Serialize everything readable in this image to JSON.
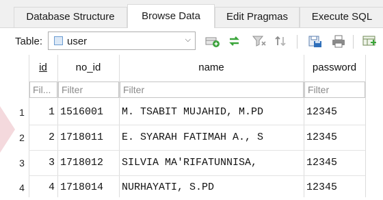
{
  "tabs": [
    {
      "label": "Database Structure",
      "active": false
    },
    {
      "label": "Browse Data",
      "active": true
    },
    {
      "label": "Edit Pragmas",
      "active": false
    },
    {
      "label": "Execute SQL",
      "active": false
    }
  ],
  "toolbar": {
    "table_label": "Table:",
    "table_value": "user",
    "icons": [
      "refresh-table-icon",
      "clear-filters-icon",
      "filter-icon",
      "sort-icon",
      "save-view-icon",
      "print-icon",
      "insert-record-icon"
    ]
  },
  "grid": {
    "columns": [
      {
        "header": "id",
        "filter_placeholder": "Fil..."
      },
      {
        "header": "no_id",
        "filter_placeholder": "Filter"
      },
      {
        "header": "name",
        "filter_placeholder": "Filter"
      },
      {
        "header": "password",
        "filter_placeholder": "Filter"
      }
    ],
    "rows": [
      {
        "row_number": "1",
        "id": "1",
        "no_id": "1516001",
        "name": "M. TSABIT MUJAHID, M.PD",
        "password": "12345"
      },
      {
        "row_number": "2",
        "id": "2",
        "no_id": "1718011",
        "name": "E. SYARAH FATIMAH A., S",
        "password": "12345"
      },
      {
        "row_number": "3",
        "id": "3",
        "no_id": "1718012",
        "name": "SILVIA MA'RIFATUNNISA,",
        "password": "12345"
      },
      {
        "row_number": "4",
        "id": "4",
        "no_id": "1718014",
        "name": "NURHAYATI, S.PD",
        "password": "12345"
      }
    ]
  },
  "colors": {
    "accent": "#2f6fba",
    "header_bg": "#f0f0f0",
    "border": "#d9d9d9",
    "decoration": "#f4d9dd"
  }
}
